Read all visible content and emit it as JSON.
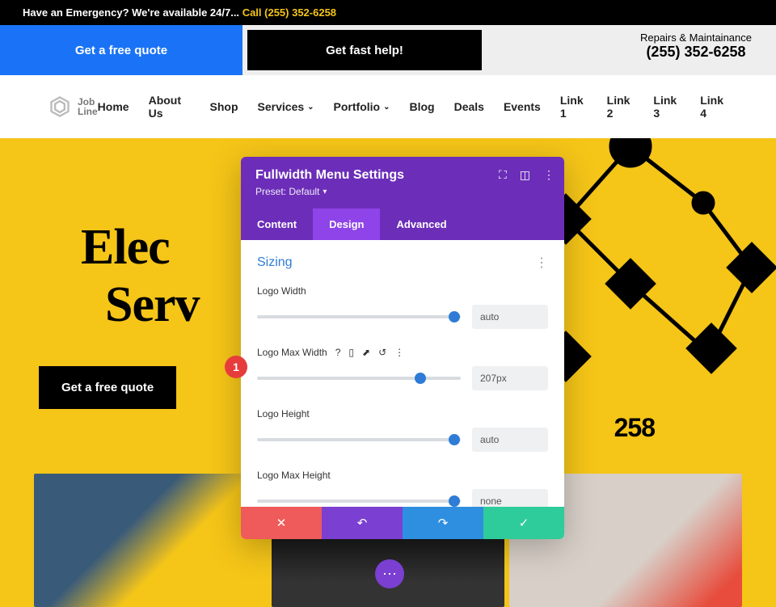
{
  "topbar": {
    "text": "Have an Emergency? We're available 24/7...",
    "call_label": "Call (255) 352-6258"
  },
  "header": {
    "quote_btn": "Get a free quote",
    "fast_btn": "Get fast help!",
    "repairs_label": "Repairs & Maintainance",
    "phone": "(255) 352-6258"
  },
  "logo": {
    "line1": "Job",
    "line2": "Line"
  },
  "nav": [
    {
      "label": "Home",
      "dropdown": false
    },
    {
      "label": "About Us",
      "dropdown": false
    },
    {
      "label": "Shop",
      "dropdown": false
    },
    {
      "label": "Services",
      "dropdown": true
    },
    {
      "label": "Portfolio",
      "dropdown": true
    },
    {
      "label": "Blog",
      "dropdown": false
    },
    {
      "label": "Deals",
      "dropdown": false
    },
    {
      "label": "Events",
      "dropdown": false
    },
    {
      "label": "Link 1",
      "dropdown": false
    },
    {
      "label": "Link 2",
      "dropdown": false
    },
    {
      "label": "Link 3",
      "dropdown": false
    },
    {
      "label": "Link 4",
      "dropdown": false
    }
  ],
  "hero": {
    "line1": "Elec",
    "line2": "Serv",
    "quote_btn": "Get a free quote",
    "phone_fragment": "258"
  },
  "panel": {
    "title": "Fullwidth Menu Settings",
    "preset": "Preset: Default",
    "tabs": {
      "content": "Content",
      "design": "Design",
      "advanced": "Advanced"
    },
    "section": "Sizing",
    "fields": {
      "logo_width": {
        "label": "Logo Width",
        "value": "auto",
        "pos": 97
      },
      "logo_max_width": {
        "label": "Logo Max Width",
        "value": "207px",
        "pos": 80
      },
      "logo_height": {
        "label": "Logo Height",
        "value": "auto",
        "pos": 97
      },
      "logo_max_height": {
        "label": "Logo Max Height",
        "value": "none",
        "pos": 97
      }
    }
  },
  "badge": "1"
}
